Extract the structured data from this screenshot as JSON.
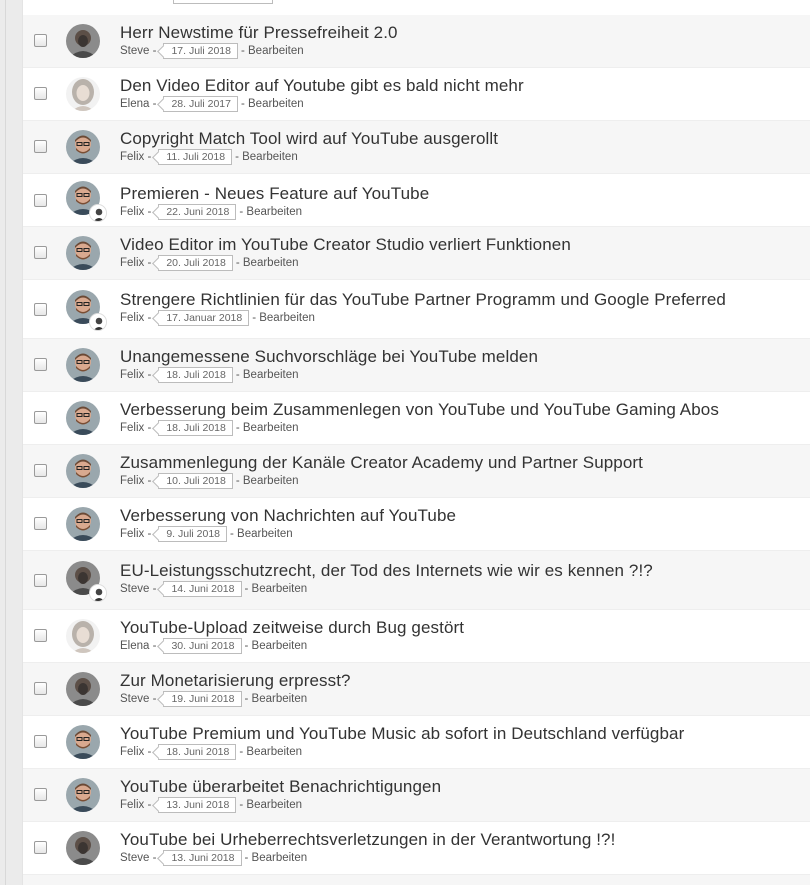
{
  "posts": [
    {
      "title": "Herr Newstime für Pressefreiheit 2.0",
      "author": "Steve",
      "date": "17. Juli 2018",
      "edit": "Bearbeiten",
      "avatar": "steve-avatar",
      "sub": false
    },
    {
      "title": "Den Video Editor auf Youtube gibt es bald nicht mehr",
      "author": "Elena",
      "date": "28. Juli 2017",
      "edit": "Bearbeiten",
      "avatar": "elena-avatar",
      "sub": false
    },
    {
      "title": "Copyright Match Tool wird auf YouTube ausgerollt",
      "author": "Felix",
      "date": "11. Juli 2018",
      "edit": "Bearbeiten",
      "avatar": "felix-avatar",
      "sub": false
    },
    {
      "title": "Premieren - Neues Feature auf YouTube",
      "author": "Felix",
      "date": "22. Juni 2018",
      "edit": "Bearbeiten",
      "avatar": "felix-avatar",
      "sub": true
    },
    {
      "title": "Video Editor im YouTube Creator Studio verliert Funktionen",
      "author": "Felix",
      "date": "20. Juli 2018",
      "edit": "Bearbeiten",
      "avatar": "felix-avatar",
      "sub": false
    },
    {
      "title": "Strengere Richtlinien für das YouTube Partner Programm und Google Preferred",
      "author": "Felix",
      "date": "17. Januar 2018",
      "edit": "Bearbeiten",
      "avatar": "felix-avatar",
      "sub": true
    },
    {
      "title": "Unangemessene Suchvorschläge bei YouTube melden",
      "author": "Felix",
      "date": "18. Juli 2018",
      "edit": "Bearbeiten",
      "avatar": "felix-avatar",
      "sub": false
    },
    {
      "title": "Verbesserung beim Zusammenlegen von YouTube und YouTube Gaming Abos",
      "author": "Felix",
      "date": "18. Juli 2018",
      "edit": "Bearbeiten",
      "avatar": "felix-avatar",
      "sub": false
    },
    {
      "title": "Zusammenlegung der Kanäle Creator Academy und Partner Support",
      "author": "Felix",
      "date": "10. Juli 2018",
      "edit": "Bearbeiten",
      "avatar": "felix-avatar",
      "sub": false
    },
    {
      "title": "Verbesserung von Nachrichten auf YouTube",
      "author": "Felix",
      "date": "9. Juli 2018",
      "edit": "Bearbeiten",
      "avatar": "felix-avatar",
      "sub": false
    },
    {
      "title": "EU-Leistungsschutzrecht, der Tod des Internets wie wir es kennen ?!?",
      "author": "Steve",
      "date": "14. Juni 2018",
      "edit": "Bearbeiten",
      "avatar": "steve-avatar",
      "sub": true
    },
    {
      "title": "YouTube-Upload zeitweise durch Bug gestört",
      "author": "Elena",
      "date": "30. Juni 2018",
      "edit": "Bearbeiten",
      "avatar": "elena-avatar",
      "sub": false
    },
    {
      "title": "Zur Monetarisierung erpresst?",
      "author": "Steve",
      "date": "19. Juni 2018",
      "edit": "Bearbeiten",
      "avatar": "steve-avatar",
      "sub": false
    },
    {
      "title": "YouTube Premium und YouTube Music ab sofort in Deutschland verfügbar",
      "author": "Felix",
      "date": "18. Juni 2018",
      "edit": "Bearbeiten",
      "avatar": "felix-avatar",
      "sub": false
    },
    {
      "title": "YouTube überarbeitet Benachrichtigungen",
      "author": "Felix",
      "date": "13. Juni 2018",
      "edit": "Bearbeiten",
      "avatar": "felix-avatar",
      "sub": false
    },
    {
      "title": "YouTube bei Urheberrechtsverletzungen in der Verantwortung !?!",
      "author": "Steve",
      "date": "13. Juni 2018",
      "edit": "Bearbeiten",
      "avatar": "steve-avatar",
      "sub": false
    }
  ]
}
